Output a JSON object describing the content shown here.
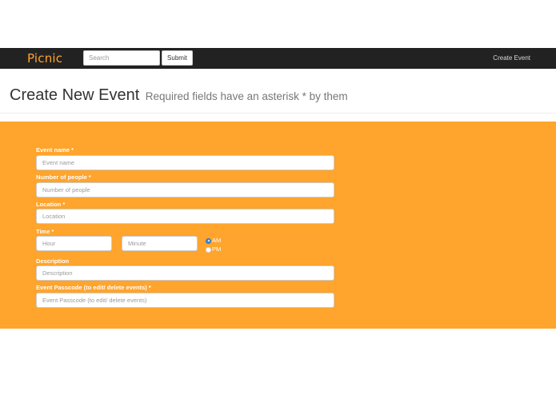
{
  "navbar": {
    "brand": "Picnic",
    "search_placeholder": "Search",
    "submit_label": "Submit",
    "create_event_link": "Create Event"
  },
  "header": {
    "title": "Create New Event",
    "subtitle": "Required fields have an asterisk * by them"
  },
  "form": {
    "event_name": {
      "label": "Event name *",
      "placeholder": "Event name"
    },
    "num_people": {
      "label": "Number of people *",
      "placeholder": "Number of people"
    },
    "location": {
      "label": "Location *",
      "placeholder": "Location"
    },
    "time": {
      "label": "Time *",
      "hour_placeholder": "Hour",
      "minute_placeholder": "Minute",
      "am_label": "AM",
      "pm_label": "PM",
      "selected": "AM"
    },
    "description": {
      "label": "Description",
      "placeholder": "Description"
    },
    "passcode": {
      "label": "Event Passcode (to edit/ delete events) *",
      "placeholder": "Event Passcode (to edit/ delete events)"
    }
  },
  "colors": {
    "accent": "#ffa42c",
    "navbar": "#222222",
    "radio_selected": "#3b8ddc"
  }
}
